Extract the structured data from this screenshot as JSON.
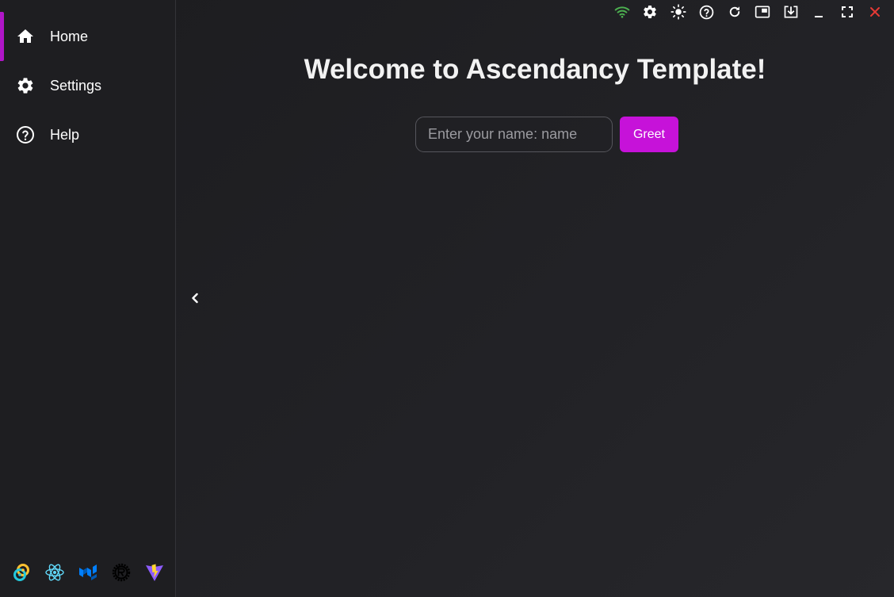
{
  "sidebar": {
    "items": [
      {
        "label": "Home",
        "icon": "home-icon",
        "active": true
      },
      {
        "label": "Settings",
        "icon": "gear-icon",
        "active": false
      },
      {
        "label": "Help",
        "icon": "help-circle-icon",
        "active": false
      }
    ],
    "tech_icons": [
      "tauri-logo-icon",
      "react-logo-icon",
      "mui-logo-icon",
      "rust-logo-icon",
      "vite-logo-icon"
    ]
  },
  "topbar": {
    "icons": [
      "wifi-icon",
      "gear-icon",
      "brightness-icon",
      "help-circle-icon",
      "refresh-icon",
      "picture-in-picture-icon",
      "download-icon",
      "minimize-icon",
      "fullscreen-icon",
      "close-icon"
    ]
  },
  "main": {
    "title": "Welcome to Ascendancy Template!",
    "name_placeholder": "Enter your name: name",
    "greet_label": "Greet"
  },
  "colors": {
    "accent": "#c612d9",
    "indicator": "#b016c8",
    "wifi": "#4caf50",
    "close": "#e53935",
    "background": "#222226",
    "sidebar": "#1e1e21"
  }
}
